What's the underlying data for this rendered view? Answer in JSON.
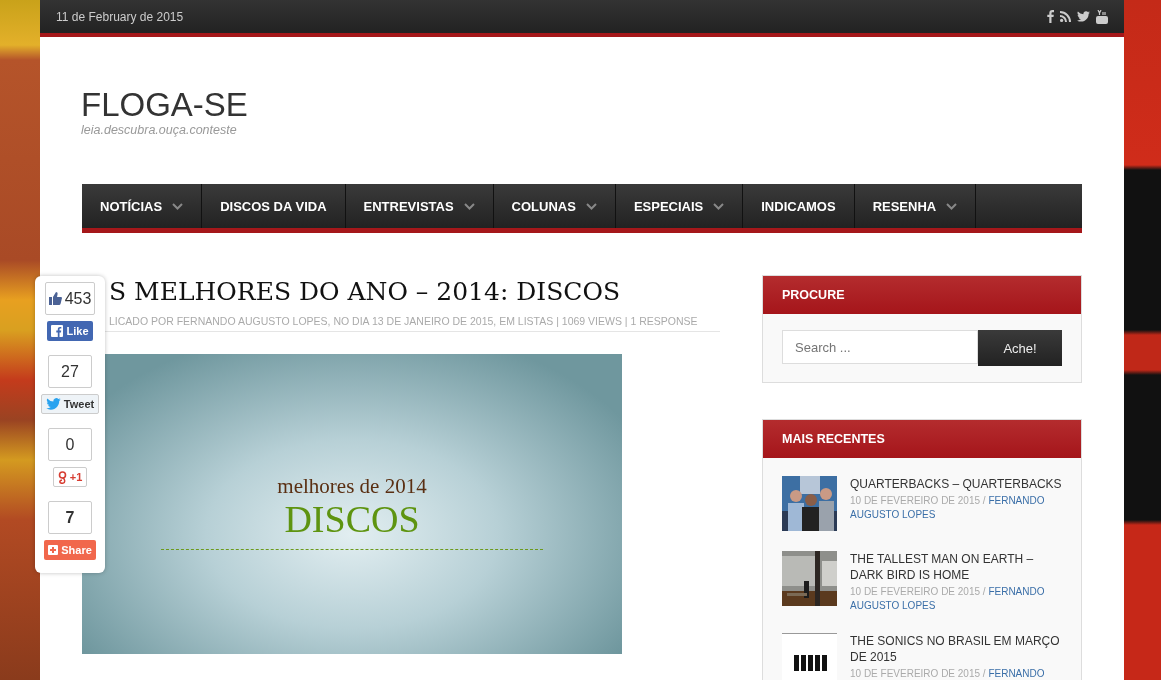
{
  "top_bar": {
    "date": "11 de February de 2015",
    "social": [
      {
        "kind": "facebook"
      },
      {
        "kind": "rss"
      },
      {
        "kind": "twitter"
      },
      {
        "kind": "youtube"
      }
    ]
  },
  "site": {
    "title": "FLOGA-SE",
    "tagline": "leia.descubra.ouça.conteste"
  },
  "nav": [
    {
      "label": "NOTÍCIAS",
      "dropdown": true
    },
    {
      "label": "DISCOS DA VIDA",
      "dropdown": false
    },
    {
      "label": "ENTREVISTAS",
      "dropdown": true
    },
    {
      "label": "COLUNAS",
      "dropdown": true
    },
    {
      "label": "ESPECIAIS",
      "dropdown": true
    },
    {
      "label": "INDICAMOS",
      "dropdown": false
    },
    {
      "label": "RESENHA",
      "dropdown": true
    }
  ],
  "article": {
    "title": "S MELHORES DO ANO – 2014: DISCOS",
    "meta": "LICADO POR FERNANDO AUGUSTO LOPES, NO DIA 13 DE JANEIRO DE 2015, EM LISTAS | 1069 VIEWS | 1 RESPONSE",
    "image": {
      "subtitle": "melhores de 2014",
      "title": "DISCOS"
    }
  },
  "share": [
    {
      "kind": "facebook",
      "count": "453",
      "label": "Like"
    },
    {
      "kind": "twitter",
      "count": "27",
      "label": "Tweet"
    },
    {
      "kind": "google",
      "count": "0",
      "label": "+1"
    },
    {
      "kind": "share",
      "count": "7",
      "label": "Share"
    }
  ],
  "sidebar": {
    "search": {
      "heading": "PROCURE",
      "placeholder": "Search ...",
      "button": "Ache!"
    },
    "recent": {
      "heading": "MAIS RECENTES",
      "posts": [
        {
          "title": "QUARTERBACKS – QUARTERBACKS",
          "date": "10 DE FEVEREIRO DE 2015 /",
          "author": "FERNANDO AUGUSTO LOPES"
        },
        {
          "title": "THE TALLEST MAN ON EARTH – DARK BIRD IS HOME",
          "date": "10 DE FEVEREIRO DE 2015 /",
          "author": "FERNANDO AUGUSTO LOPES"
        },
        {
          "title": "THE SONICS NO BRASIL EM MARÇO DE 2015",
          "date": "10 DE FEVEREIRO DE 2015 /",
          "author": "FERNANDO"
        }
      ]
    }
  }
}
